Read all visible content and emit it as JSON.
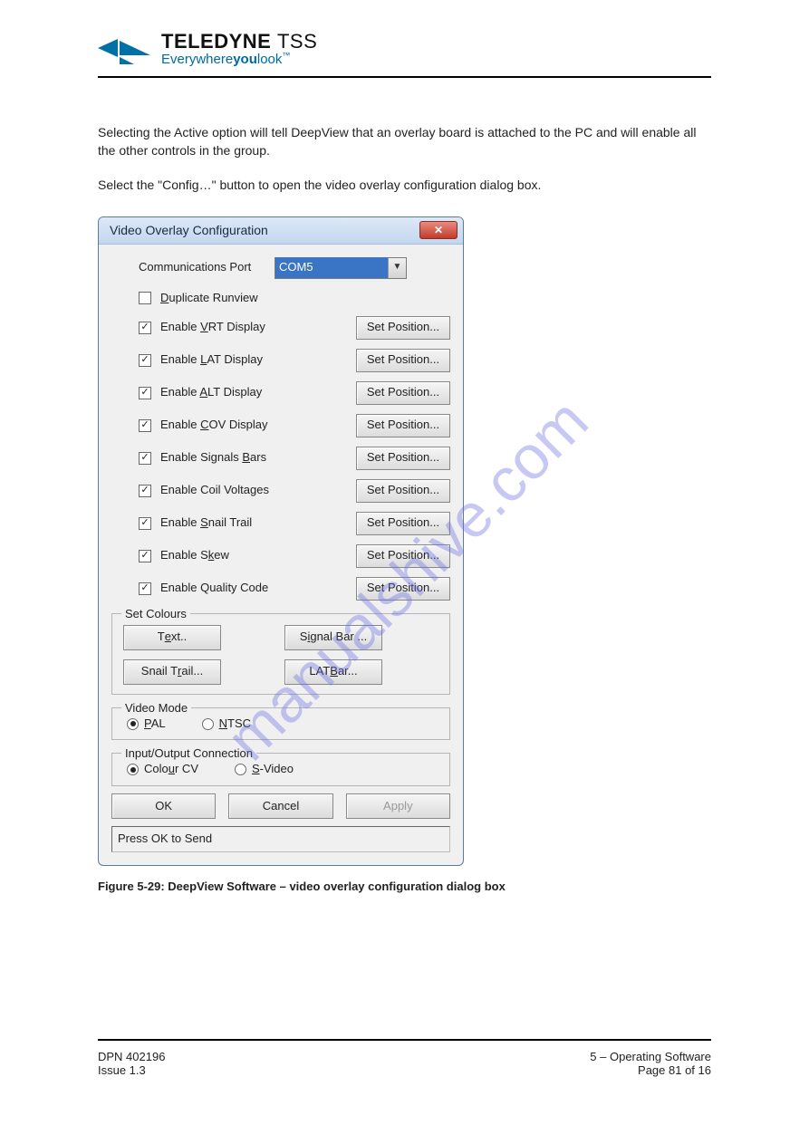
{
  "brand": {
    "name_main": "TELEDYNE",
    "name_sub": "TSS",
    "tagline_pre": "Everywhere",
    "tagline_bold": "you",
    "tagline_post": "look",
    "tm": "™"
  },
  "intro": {
    "p1": "Selecting the Active option will tell DeepView that an overlay board is attached to the PC and will enable all the other controls in the group.",
    "p2": "Select the \"Config…\" button to open the video overlay configuration dialog box."
  },
  "dialog": {
    "title": "Video Overlay Configuration",
    "port_label": "Communications Port",
    "port_value": "COM5",
    "duplicate_pre": "D",
    "duplicate_post": "uplicate Runview",
    "items": [
      {
        "pre": "Enable ",
        "ul": "V",
        "post": "RT Display",
        "checked": true,
        "btn": "Set Position..."
      },
      {
        "pre": "Enable ",
        "ul": "L",
        "post": "AT Display",
        "checked": true,
        "btn": "Set Position..."
      },
      {
        "pre": "Enable ",
        "ul": "A",
        "post": "LT Display",
        "checked": true,
        "btn": "Set Position..."
      },
      {
        "pre": "Enable ",
        "ul": "C",
        "post": "OV Display",
        "checked": true,
        "btn": "Set Position..."
      },
      {
        "pre": "Enable Signals ",
        "ul": "B",
        "post": "ars",
        "checked": true,
        "btn": "Set Position..."
      },
      {
        "pre": "Enable Coil Voltages",
        "ul": "",
        "post": "",
        "checked": true,
        "btn": "Set Position..."
      },
      {
        "pre": "Enable ",
        "ul": "S",
        "post": "nail Trail",
        "checked": true,
        "btn": "Set Position..."
      },
      {
        "pre": "Enable S",
        "ul": "k",
        "post": "ew",
        "checked": true,
        "btn": "Set Position..."
      },
      {
        "pre": "Enable Quality Code",
        "ul": "",
        "post": "",
        "checked": true,
        "btn": "Set Position..."
      }
    ],
    "colours": {
      "legend": "Set Colours",
      "text_pre": "T",
      "text_ul": "e",
      "text_post": "xt..",
      "signal_pre": "S",
      "signal_ul": "i",
      "signal_post": "gnal Bar ...",
      "snail_pre": "Snail T",
      "snail_ul": "r",
      "snail_post": "ail...",
      "lat_pre": "LAT ",
      "lat_ul": "B",
      "lat_post": "ar..."
    },
    "video_mode": {
      "legend": "Video Mode",
      "pal_ul": "P",
      "pal_post": "AL",
      "ntsc_ul": "N",
      "ntsc_post": "TSC"
    },
    "io": {
      "legend": "Input/Output Connection",
      "colour_pre": "Colo",
      "colour_ul": "u",
      "colour_post": "r CV",
      "svideo_ul": "S",
      "svideo_post": "-Video"
    },
    "ok": "OK",
    "cancel": "Cancel",
    "apply": "Apply",
    "status": "Press OK to Send"
  },
  "figure": "Figure 5-29: DeepView Software – video overlay configuration dialog box",
  "footer": {
    "left": "DPN 402196",
    "right": "5 – Operating Software",
    "issue": "Issue 1.3",
    "page": "Page 81 of 16"
  },
  "watermark": "manualshive.com"
}
